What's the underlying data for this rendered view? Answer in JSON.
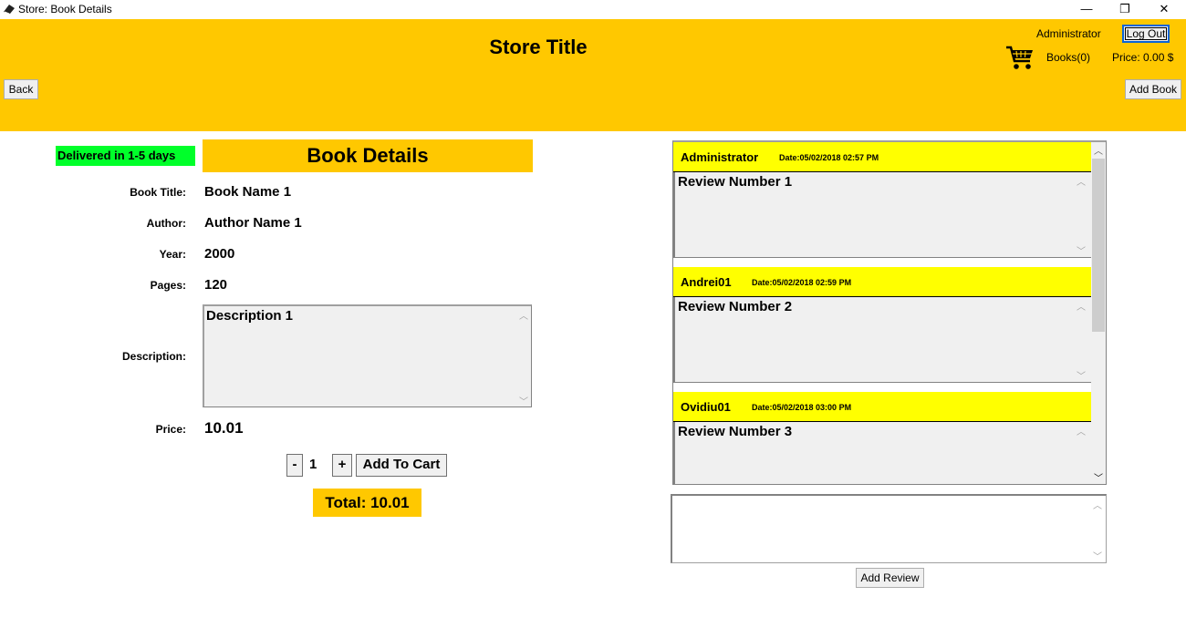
{
  "window": {
    "title": "Store: Book Details",
    "minimize": "—",
    "maximize": "❐",
    "close": "✕"
  },
  "header": {
    "store_title": "Store Title",
    "user_name": "Administrator",
    "logout_label": "Log Out",
    "books_count": "Books(0)",
    "price": "Price: 0.00 $",
    "back_label": "Back",
    "add_book_label": "Add Book",
    "cart_icon": "shopping-cart-icon",
    "background_color": "#ffc800"
  },
  "details": {
    "delivered": "Delivered in 1-5 days",
    "heading": "Book Details",
    "fields": [
      {
        "label": "Book Title:",
        "value": "Book Name 1"
      },
      {
        "label": "Author:",
        "value": "Author Name 1"
      },
      {
        "label": "Year:",
        "value": "2000"
      },
      {
        "label": "Pages:",
        "value": "120"
      }
    ],
    "description_label": "Description:",
    "description": "Description 1",
    "price_label": "Price:",
    "price": "10.01",
    "minus_label": "-",
    "quantity": "1",
    "plus_label": "+",
    "add_to_cart_label": "Add To Cart",
    "total": "Total: 10.01"
  },
  "reviews": {
    "items": [
      {
        "author": "Administrator",
        "date": "Date:05/02/2018 02:57 PM",
        "text": "Review Number 1"
      },
      {
        "author": "Andrei01",
        "date": "Date:05/02/2018 02:59 PM",
        "text": "Review Number 2"
      },
      {
        "author": "Ovidiu01",
        "date": "Date:05/02/2018 03:00 PM",
        "text": "Review Number 3"
      }
    ],
    "new_review_value": "",
    "add_review_label": "Add Review",
    "header_color": "#ffff00"
  },
  "colors": {
    "accent": "#ffc800",
    "delivered_green": "#00ff2a"
  }
}
